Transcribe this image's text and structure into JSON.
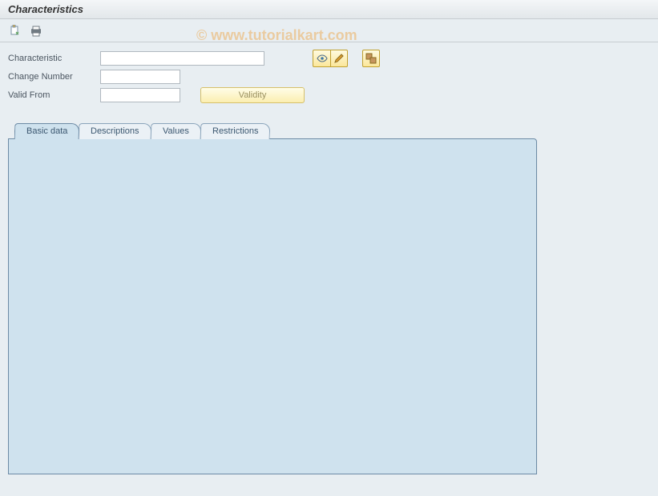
{
  "title": "Characteristics",
  "watermark": "© www.tutorialkart.com",
  "toolbar": {
    "create_icon": "create-icon",
    "print_icon": "print-icon"
  },
  "form": {
    "characteristic_label": "Characteristic",
    "characteristic_value": "",
    "change_number_label": "Change Number",
    "change_number_value": "",
    "valid_from_label": "Valid From",
    "valid_from_value": "",
    "validity_button": "Validity"
  },
  "action_buttons": {
    "display": "display-icon",
    "change": "change-icon",
    "other": "other-icon"
  },
  "tabs": {
    "items": [
      {
        "label": "Basic data",
        "active": true
      },
      {
        "label": "Descriptions",
        "active": false
      },
      {
        "label": "Values",
        "active": false
      },
      {
        "label": "Restrictions",
        "active": false
      }
    ]
  }
}
